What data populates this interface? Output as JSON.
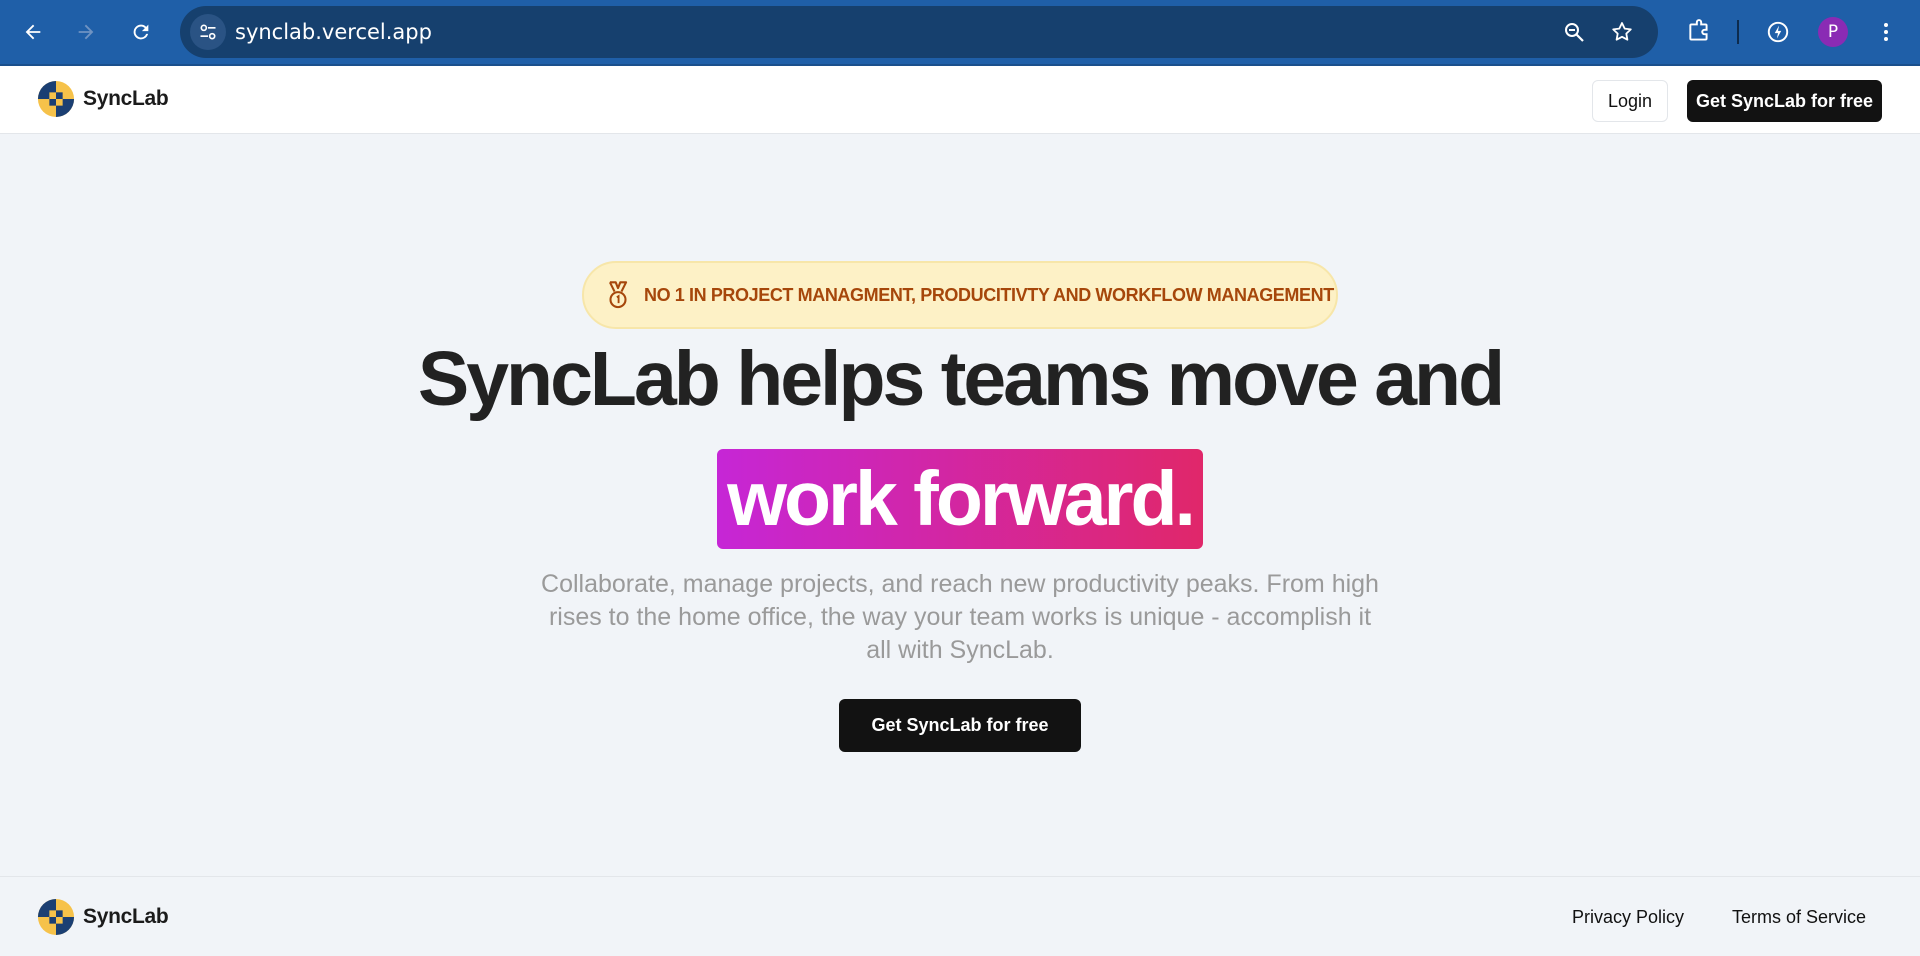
{
  "browser": {
    "url": "synclab.vercel.app",
    "profile_initial": "P",
    "icons": [
      "back-arrow-icon",
      "forward-arrow-icon",
      "reload-icon",
      "site-settings-icon",
      "zoom-icon",
      "bookmark-star-icon",
      "extensions-icon",
      "performance-icon",
      "more-vert-icon"
    ],
    "colors": {
      "toolbar": "#1f5fa8",
      "omnibox": "#16406e",
      "avatar": "#8a2bb4"
    }
  },
  "header": {
    "brand": "SyncLab",
    "login_label": "Login",
    "cta_label": "Get SyncLab for free"
  },
  "hero": {
    "badge": "NO 1 IN PROJECT MANAGMENT, PRODUCITIVTY AND WORKFLOW MANAGEMENT",
    "headline": "SyncLab helps teams move and",
    "highlight": "work forward.",
    "subtext": "Collaborate, manage projects, and reach new productivity peaks. From high rises to the home office, the way your team works is unique - accomplish it all with SyncLab.",
    "cta_label": "Get SyncLab for free"
  },
  "footer": {
    "brand": "SyncLab",
    "links": [
      "Privacy Policy",
      "Terms of Service"
    ]
  },
  "colors": {
    "page_bg": "#f1f4f8",
    "badge_bg": "#fdf1c6",
    "badge_text": "#a6470b",
    "highlight_start": "#c626d6",
    "highlight_end": "#e0276a",
    "button_dark": "#121212"
  }
}
